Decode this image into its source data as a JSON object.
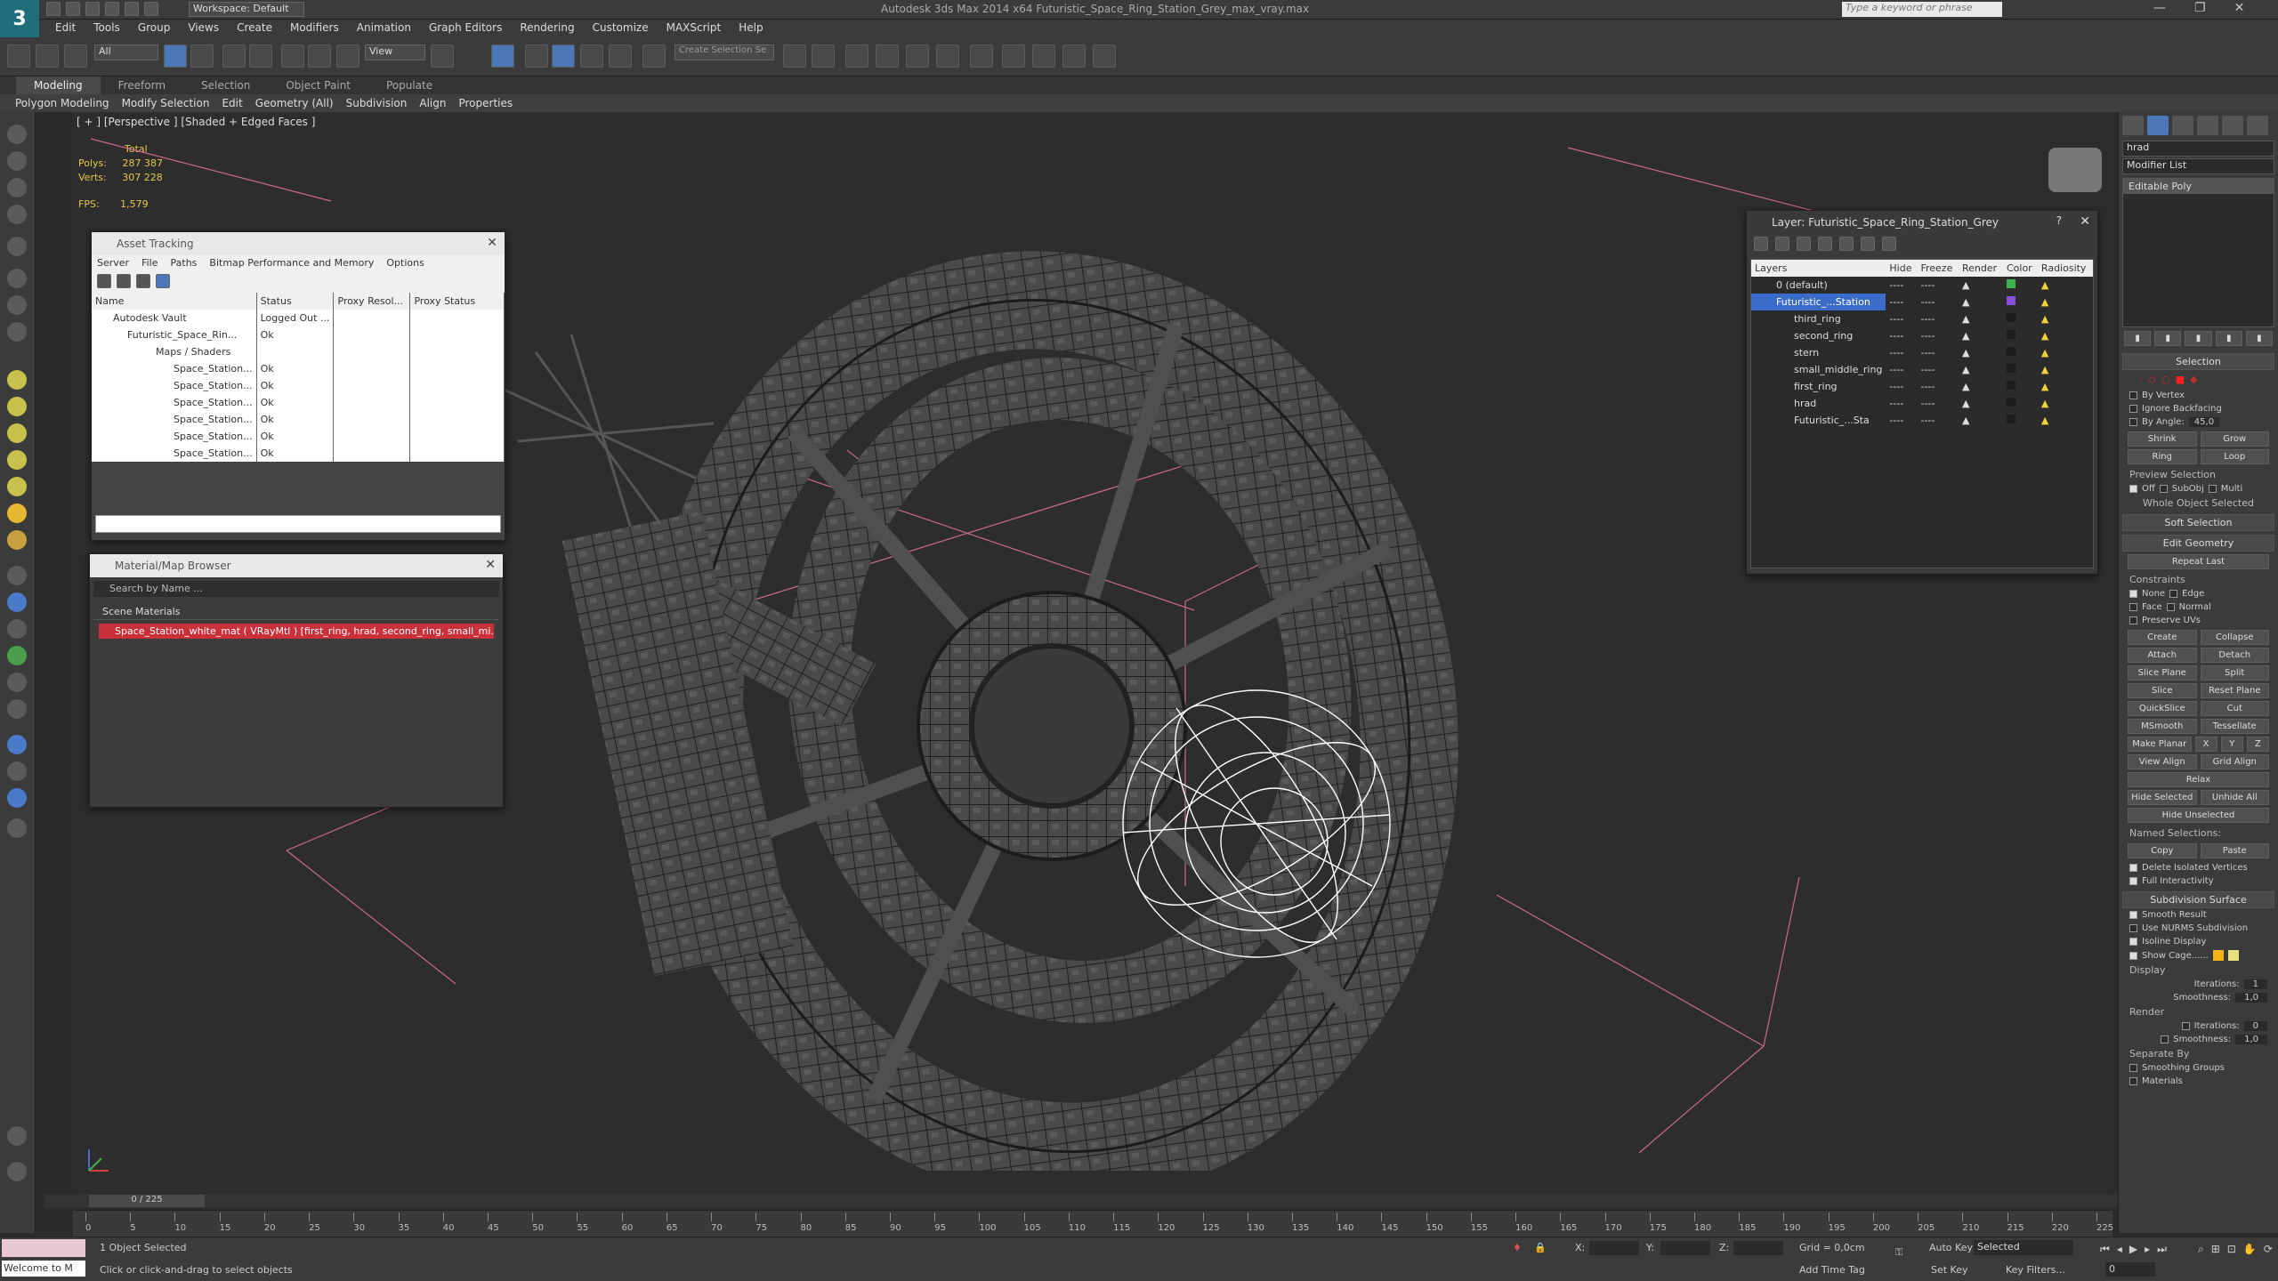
{
  "titlebar": {
    "workspace": "Workspace: Default",
    "app_title": "Autodesk 3ds Max  2014 x64     Futuristic_Space_Ring_Station_Grey_max_vray.max",
    "search_placeholder": "Type a keyword or phrase",
    "minimize": "—",
    "restore": "❐",
    "close": "✕"
  },
  "menu": [
    "Edit",
    "Tools",
    "Group",
    "Views",
    "Create",
    "Modifiers",
    "Animation",
    "Graph Editors",
    "Rendering",
    "Customize",
    "MAXScript",
    "Help"
  ],
  "toolbar": {
    "selection_filter": "All",
    "ref_coord": "View",
    "named_selection": "Create Selection Se"
  },
  "ribbon": {
    "tabs": [
      "Modeling",
      "Freeform",
      "Selection",
      "Object Paint",
      "Populate"
    ],
    "subtabs": [
      "Polygon Modeling",
      "Modify Selection",
      "Edit",
      "Geometry (All)",
      "Subdivision",
      "Align",
      "Properties"
    ]
  },
  "viewport": {
    "label": "[ + ] [Perspective ] [Shaded + Edged Faces ]",
    "stats_total": "Total",
    "polys_label": "Polys:",
    "polys_value": "287 387",
    "verts_label": "Verts:",
    "verts_value": "307 228",
    "fps_label": "FPS:",
    "fps_value": "1,579"
  },
  "asset_tracking": {
    "title": "Asset Tracking",
    "menu": [
      "Server",
      "File",
      "Paths",
      "Bitmap Performance and Memory",
      "Options"
    ],
    "columns": [
      "Name",
      "Status",
      "Proxy Resol...",
      "Proxy Status"
    ],
    "rows": [
      {
        "name": "Autodesk Vault",
        "status": "Logged Out ..."
      },
      {
        "name": "Futuristic_Space_Rin...",
        "status": "Ok"
      },
      {
        "name": "Maps / Shaders",
        "status": ""
      },
      {
        "name": "Space_Station...",
        "status": "Ok"
      },
      {
        "name": "Space_Station...",
        "status": "Ok"
      },
      {
        "name": "Space_Station...",
        "status": "Ok"
      },
      {
        "name": "Space_Station...",
        "status": "Ok"
      },
      {
        "name": "Space_Station...",
        "status": "Ok"
      },
      {
        "name": "Space_Station...",
        "status": "Ok"
      }
    ]
  },
  "material_browser": {
    "title": "Material/Map Browser",
    "search_placeholder": "Search by Name ...",
    "group": "Scene Materials",
    "item": "Space_Station_white_mat  ( VRayMtl ) [first_ring, hrad, second_ring, small_mi..."
  },
  "layer_window": {
    "title": "Layer: Futuristic_Space_Ring_Station_Grey",
    "help": "?",
    "columns": [
      "Layers",
      "Hide",
      "Freeze",
      "Render",
      "Color",
      "Radiosity"
    ],
    "rows": [
      {
        "name": "0 (default)",
        "color": "#3fb34f"
      },
      {
        "name": "Futuristic_...Station",
        "color": "#8a4fd8"
      },
      {
        "name": "third_ring",
        "color": "#1d1d1d"
      },
      {
        "name": "second_ring",
        "color": "#1d1d1d"
      },
      {
        "name": "stern",
        "color": "#1d1d1d"
      },
      {
        "name": "small_middle_ring",
        "color": "#1d1d1d"
      },
      {
        "name": "first_ring",
        "color": "#1d1d1d"
      },
      {
        "name": "hrad",
        "color": "#1d1d1d"
      },
      {
        "name": "Futuristic_...Sta",
        "color": "#1d1d1d"
      }
    ],
    "dash": "----"
  },
  "command_panel": {
    "object_name": "hrad",
    "modifier_list": "Modifier List",
    "stack_item": "Editable Poly",
    "selection": {
      "title": "Selection",
      "by_vertex": "By Vertex",
      "ignore_backfacing": "Ignore Backfacing",
      "by_angle": "By Angle:",
      "angle_value": "45,0",
      "shrink": "Shrink",
      "grow": "Grow",
      "ring": "Ring",
      "loop": "Loop",
      "preview": "Preview Selection",
      "off": "Off",
      "subobj": "SubObj",
      "multi": "Multi",
      "whole": "Whole Object Selected"
    },
    "soft_selection": "Soft Selection",
    "edit_geometry": {
      "title": "Edit Geometry",
      "repeat_last": "Repeat Last",
      "constraints": "Constraints",
      "none": "None",
      "edge": "Edge",
      "face": "Face",
      "normal": "Normal",
      "preserve_uvs": "Preserve UVs",
      "create": "Create",
      "collapse": "Collapse",
      "attach": "Attach",
      "detach": "Detach",
      "slice_plane": "Slice Plane",
      "split": "Split",
      "slice": "Slice",
      "reset_plane": "Reset Plane",
      "quickslice": "QuickSlice",
      "cut": "Cut",
      "msmooth": "MSmooth",
      "tessellate": "Tessellate",
      "make_planar": "Make Planar",
      "x": "X",
      "y": "Y",
      "z": "Z",
      "view_align": "View Align",
      "grid_align": "Grid Align",
      "relax": "Relax",
      "hide_selected": "Hide Selected",
      "unhide_all": "Unhide All",
      "hide_unselected": "Hide Unselected",
      "named_selections": "Named Selections:",
      "copy": "Copy",
      "paste": "Paste",
      "delete_isolated": "Delete Isolated Vertices",
      "full_interactivity": "Full Interactivity"
    },
    "subdivision": {
      "title": "Subdivision Surface",
      "smooth_result": "Smooth Result",
      "use_nurms": "Use NURMS Subdivision",
      "isoline": "Isoline Display",
      "show_cage": "Show Cage......",
      "display": "Display",
      "iterations": "Iterations:",
      "iter_value": "1",
      "smoothness": "Smoothness:",
      "smooth_value": "1,0",
      "render": "Render",
      "r_iter_value": "0",
      "r_smooth_value": "1,0",
      "separate_by": "Separate By",
      "smoothing_groups": "Smoothing Groups",
      "materials": "Materials"
    },
    "cage_color1": "#f2b514",
    "cage_color2": "#e8e07a"
  },
  "timeline": {
    "frame": "0 / 225",
    "ticks": [
      "0",
      "5",
      "10",
      "15",
      "20",
      "25",
      "30",
      "35",
      "40",
      "45",
      "50",
      "55",
      "60",
      "65",
      "70",
      "75",
      "80",
      "85",
      "90",
      "95",
      "100",
      "105",
      "110",
      "115",
      "120",
      "125",
      "130",
      "135",
      "140",
      "145",
      "150",
      "155",
      "160",
      "165",
      "170",
      "175",
      "180",
      "185",
      "190",
      "195",
      "200",
      "205",
      "210",
      "215",
      "220",
      "225"
    ]
  },
  "status": {
    "maxscript": "Welcome to M",
    "selected": "1 Object Selected",
    "prompt": "Click or click-and-drag to select objects",
    "x": "X:",
    "y": "Y:",
    "z": "Z:",
    "grid": "Grid = 0,0cm",
    "add_time_tag": "Add Time Tag",
    "auto_key": "Auto Key",
    "set_key": "Set Key",
    "key_mode": "Selected",
    "key_filters": "Key Filters...",
    "frame_value": "0"
  }
}
